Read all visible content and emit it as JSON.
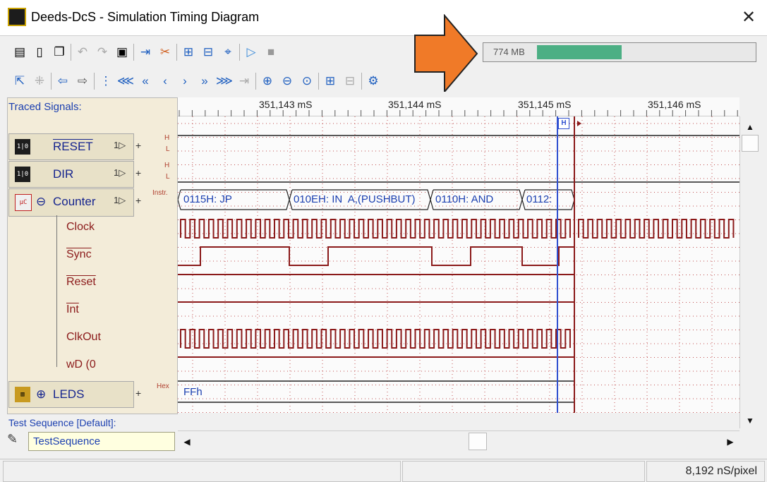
{
  "window": {
    "title": "Deeds-DcS  -  Simulation Timing Diagram",
    "close_glyph": "✕"
  },
  "memory": {
    "label": "774 MB",
    "fraction": 0.4,
    "bar_color": "#4caf84"
  },
  "ruler": {
    "labels": [
      "351,143 mS",
      "351,144 mS",
      "351,145 mS",
      "351,146 mS"
    ]
  },
  "panel": {
    "traced_title": "Traced Signals:"
  },
  "signals": [
    {
      "name": "RESET",
      "icon": "switch-icon",
      "level_labels": [
        "H",
        "L"
      ]
    },
    {
      "name": "DIR",
      "icon": "switch-icon",
      "level_labels": [
        "H",
        "L"
      ]
    },
    {
      "name": "Counter",
      "icon": "microcontroller-icon",
      "level_labels": [
        "Instr."
      ]
    },
    {
      "name": "LEDS",
      "icon": "led-icon",
      "level_labels": [
        "Hex"
      ]
    }
  ],
  "counter_subsignals": [
    "Clock",
    "Sync",
    "Reset",
    "Int",
    "ClkOut",
    "wD (0"
  ],
  "instructions": [
    "0115H: JP",
    "010EH: IN  A,(PUSHBUT)",
    "0110H: AND",
    "0112:"
  ],
  "leds_value": "FFh",
  "cursor_marker": "H",
  "test_sequence": {
    "title": "Test Sequence [Default]:",
    "value": "TestSequence"
  },
  "status": {
    "resolution": "8,192 nS/pixel"
  },
  "colors": {
    "accent_blue": "#1b3fb0",
    "signal_red": "#8b1a1a",
    "cursor_blue": "#3050d0",
    "callout_orange": "#f07a28"
  }
}
